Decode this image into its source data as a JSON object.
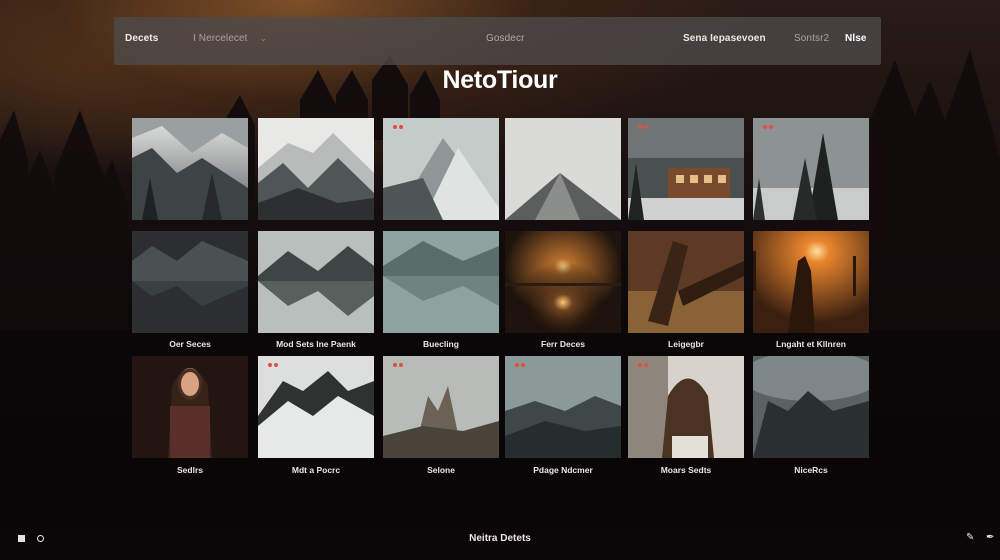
{
  "topbar": {
    "left_label": "Decets",
    "select_value": "I Nercelecet",
    "center_label": "Gosdecr",
    "right_item_1": "Sena Iepasevoen",
    "right_item_2": "Sontsr2",
    "right_item_3": "Nlse"
  },
  "page": {
    "title": "NetoTiour"
  },
  "gallery": {
    "row1": [
      {
        "icon": "snowy-forest-mountain"
      },
      {
        "icon": "snowy-peaks"
      },
      {
        "icon": "mountain-pass",
        "badge": true
      },
      {
        "icon": "single-peak"
      },
      {
        "icon": "lodge-in-snow",
        "badge": true
      },
      {
        "icon": "pine-trees-snow",
        "badge": true
      }
    ],
    "row2": [
      {
        "icon": "dark-lake-reflection",
        "caption": "Oer Seces"
      },
      {
        "icon": "mountain-lake-reflection",
        "caption": "Mod Sets Ine Paenk"
      },
      {
        "icon": "teal-lake-reflection",
        "caption": "Buecling"
      },
      {
        "icon": "sun-reflection",
        "caption": "Ferr Deces"
      },
      {
        "icon": "fallen-logs",
        "caption": "Leigegbr"
      },
      {
        "icon": "sunset-figure",
        "caption": "Lngaht et Kllnren"
      }
    ],
    "row3": [
      {
        "icon": "woman-portrait",
        "caption": "Sedlrs"
      },
      {
        "icon": "snowy-ridge",
        "caption": "Mdt a Pocrc",
        "badge": true
      },
      {
        "icon": "rock-spires",
        "caption": "Selone",
        "badge": true
      },
      {
        "icon": "valley-clouds",
        "caption": "Pdage Ndcmer",
        "badge": true
      },
      {
        "icon": "hair-portrait",
        "caption": "Moars Sedts",
        "badge": true
      },
      {
        "icon": "stormy-mountains",
        "caption": "NiceRcs"
      }
    ]
  },
  "bottombar": {
    "label": "Neitra Detets",
    "left_icons": [
      "stop-icon",
      "record-icon"
    ],
    "right_icons": [
      "pencil-icon",
      "pen-icon"
    ]
  }
}
